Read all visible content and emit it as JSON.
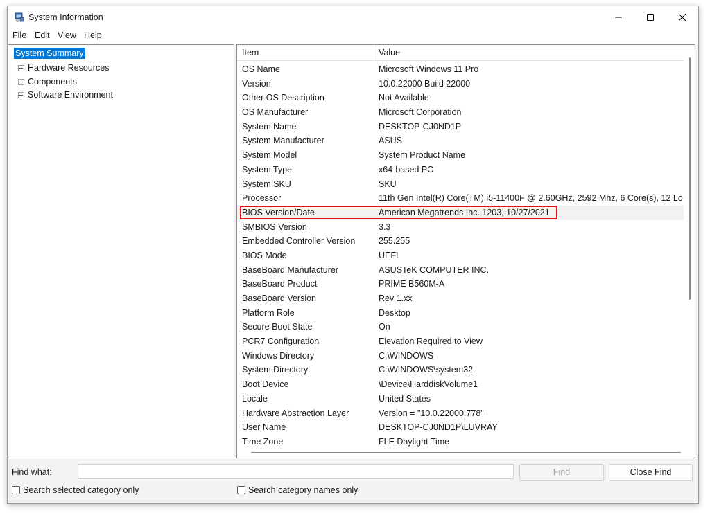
{
  "window": {
    "title": "System Information"
  },
  "controls": {
    "minimize": "—",
    "maximize": "☐",
    "close": "✕"
  },
  "menu": [
    "File",
    "Edit",
    "View",
    "Help"
  ],
  "tree": {
    "root": "System Summary",
    "children": [
      "Hardware Resources",
      "Components",
      "Software Environment"
    ]
  },
  "table": {
    "columns": [
      "Item",
      "Value"
    ],
    "rows": [
      [
        "OS Name",
        "Microsoft Windows 11 Pro"
      ],
      [
        "Version",
        "10.0.22000 Build 22000"
      ],
      [
        "Other OS Description",
        "Not Available"
      ],
      [
        "OS Manufacturer",
        "Microsoft Corporation"
      ],
      [
        "System Name",
        "DESKTOP-CJ0ND1P"
      ],
      [
        "System Manufacturer",
        "ASUS"
      ],
      [
        "System Model",
        "System Product Name"
      ],
      [
        "System Type",
        "x64-based PC"
      ],
      [
        "System SKU",
        "SKU"
      ],
      [
        "Processor",
        "11th Gen Intel(R) Core(TM) i5-11400F @ 2.60GHz, 2592 Mhz, 6 Core(s), 12 Lo"
      ],
      [
        "BIOS Version/Date",
        "American Megatrends Inc. 1203, 10/27/2021"
      ],
      [
        "SMBIOS Version",
        "3.3"
      ],
      [
        "Embedded Controller Version",
        "255.255"
      ],
      [
        "BIOS Mode",
        "UEFI"
      ],
      [
        "BaseBoard Manufacturer",
        "ASUSTeK COMPUTER INC."
      ],
      [
        "BaseBoard Product",
        "PRIME B560M-A"
      ],
      [
        "BaseBoard Version",
        "Rev 1.xx"
      ],
      [
        "Platform Role",
        "Desktop"
      ],
      [
        "Secure Boot State",
        "On"
      ],
      [
        "PCR7 Configuration",
        "Elevation Required to View"
      ],
      [
        "Windows Directory",
        "C:\\WINDOWS"
      ],
      [
        "System Directory",
        "C:\\WINDOWS\\system32"
      ],
      [
        "Boot Device",
        "\\Device\\HarddiskVolume1"
      ],
      [
        "Locale",
        "United States"
      ],
      [
        "Hardware Abstraction Layer",
        "Version = \"10.0.22000.778\""
      ],
      [
        "User Name",
        "DESKTOP-CJ0ND1P\\LUVRAY"
      ],
      [
        "Time Zone",
        "FLE Daylight Time"
      ]
    ],
    "highlighted_row": 10,
    "highlight_color": "#e8101c"
  },
  "find": {
    "label": "Find what:",
    "value": "",
    "find_button": "Find",
    "close_find_button": "Close Find",
    "search_selected": "Search selected category only",
    "search_names": "Search category names only"
  },
  "colors": {
    "selection": "#0078d7"
  }
}
